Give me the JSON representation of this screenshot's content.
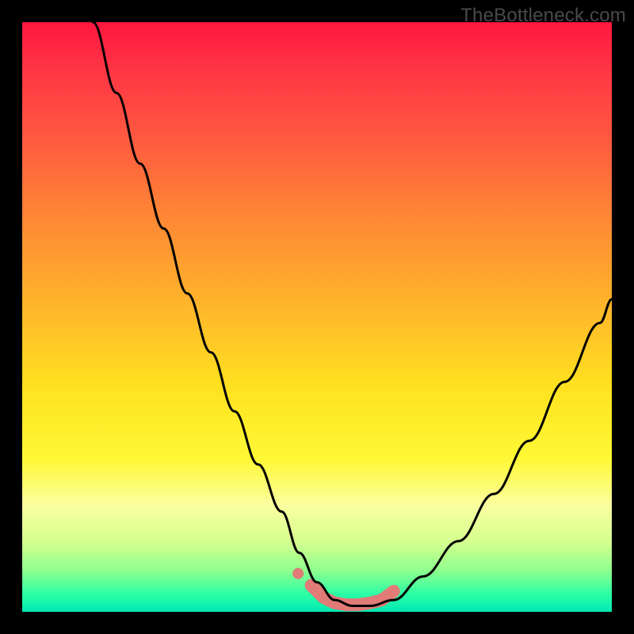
{
  "watermark": "TheBottleneck.com",
  "chart_data": {
    "type": "line",
    "title": "",
    "xlabel": "",
    "ylabel": "",
    "xlim": [
      0,
      100
    ],
    "ylim": [
      0,
      100
    ],
    "series": [
      {
        "name": "bottleneck-curve",
        "x": [
          12,
          16,
          20,
          24,
          28,
          32,
          36,
          40,
          44,
          47,
          50,
          53,
          56,
          59,
          63,
          68,
          74,
          80,
          86,
          92,
          98,
          100
        ],
        "values": [
          100,
          88,
          76,
          65,
          54,
          44,
          34,
          25,
          17,
          10,
          5,
          2,
          1,
          1,
          2,
          6,
          12,
          20,
          29,
          39,
          49,
          53
        ]
      },
      {
        "name": "optimal-band",
        "x": [
          49,
          51,
          53,
          55,
          57,
          59,
          61,
          63
        ],
        "values": [
          4.5,
          2.5,
          1.5,
          1.2,
          1.2,
          1.5,
          2.0,
          3.5
        ]
      }
    ],
    "colors": {
      "curve": "#000000",
      "band": "#e07b78"
    }
  }
}
